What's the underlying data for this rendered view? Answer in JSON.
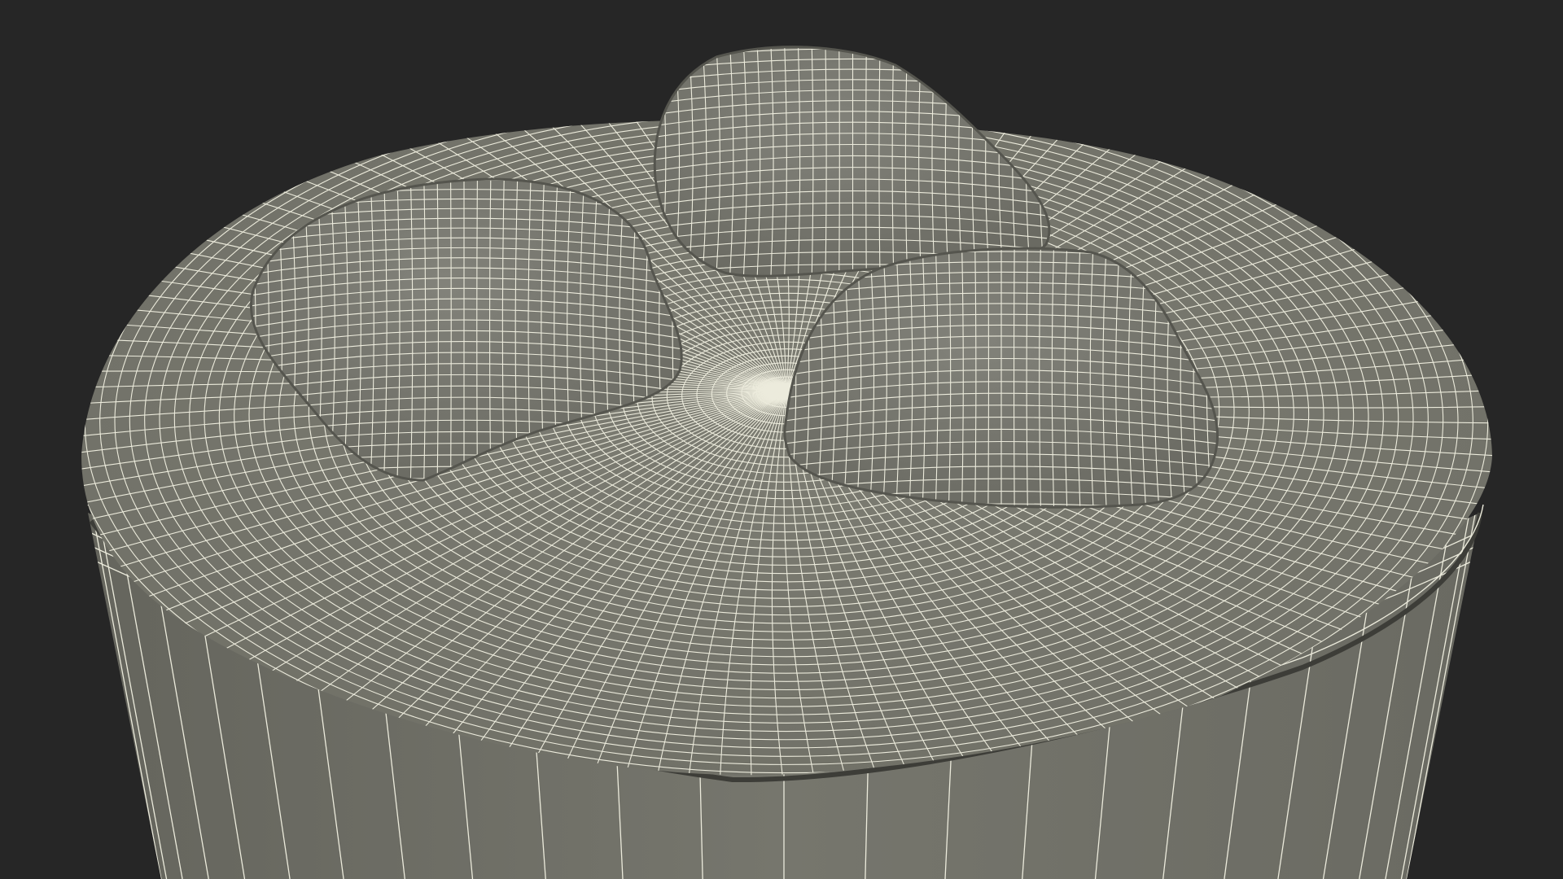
{
  "viewport": {
    "background_color": "#262626",
    "content": "wireframe-3d-model"
  },
  "model": {
    "surface_color": "#7a7a70",
    "surface_shade_color": "#65655d",
    "surface_highlight_color": "#8a8a80",
    "wire_color": "#ecebdc",
    "seam_color": "#4a4a44",
    "lid_bumps": 3
  }
}
